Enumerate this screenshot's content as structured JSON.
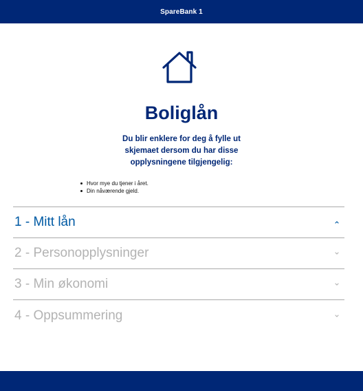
{
  "header": {
    "brand": "SpareBank 1"
  },
  "page": {
    "icon": "house-icon",
    "title": "Boliglån",
    "intro": "Du blir enklere for deg å fylle ut skjemaet dersom du har disse opplysningene tilgjengelig:",
    "bullets": [
      "Hvor mye du tjener i året.",
      "Din nåværende gjeld."
    ]
  },
  "steps": [
    {
      "label": "1 - Mitt lån",
      "expanded": true,
      "icon": "chevron-up-icon"
    },
    {
      "label": "2 - Personopplysninger",
      "expanded": false,
      "icon": "chevron-down-icon"
    },
    {
      "label": "3 - Min økonomi",
      "expanded": false,
      "icon": "chevron-down-icon"
    },
    {
      "label": "4 - Oppsummering",
      "expanded": false,
      "icon": "chevron-down-icon"
    }
  ],
  "colors": {
    "brand_navy": "#002776",
    "active_step": "#005aa4",
    "inactive_step": "#b3b3b3",
    "divider": "#aaaaaa"
  }
}
